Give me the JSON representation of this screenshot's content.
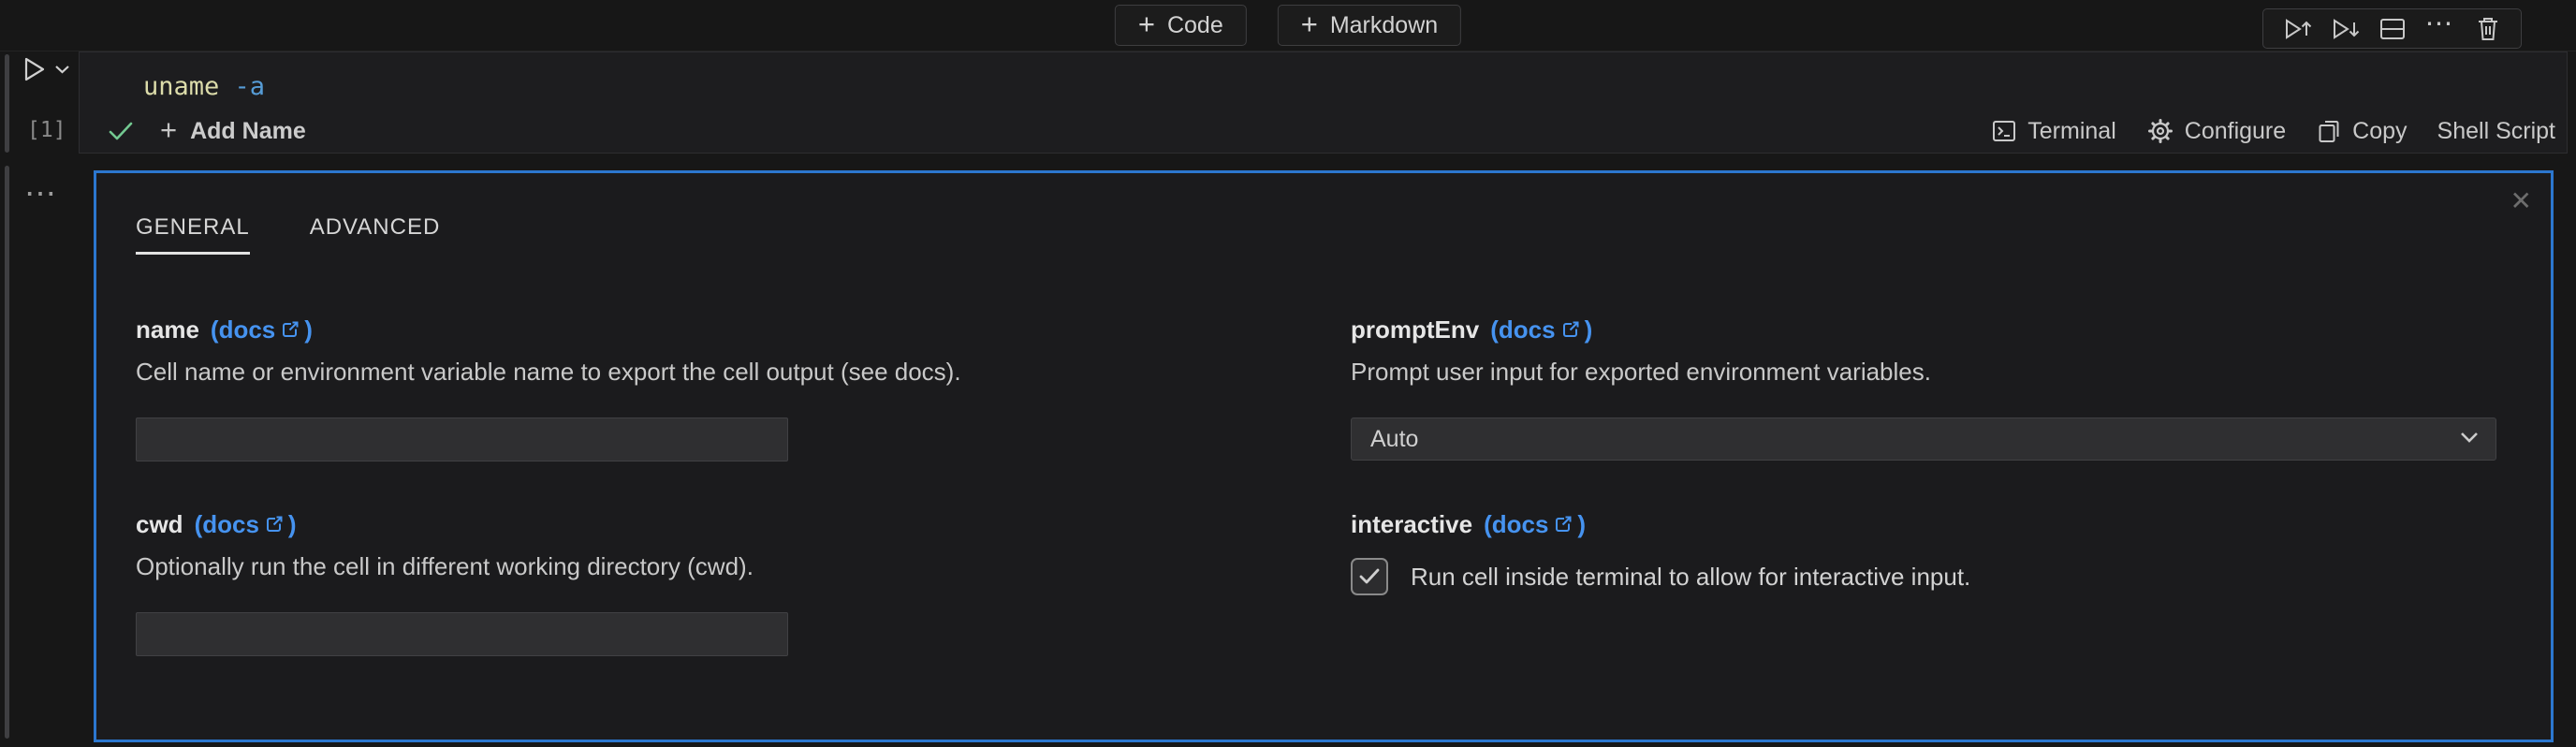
{
  "topbar": {
    "add_code_label": "Code",
    "add_markdown_label": "Markdown",
    "toolbar_icons": [
      "run-above",
      "run-below",
      "split-cell",
      "more-actions",
      "delete-cell"
    ]
  },
  "icons": {
    "plus": "+",
    "ellipsis": "⋯",
    "close": "✕",
    "run": "play-outline-with-dropdown-chevron",
    "status_check": "checkmark",
    "terminal": "terminal-box",
    "configure": "gear",
    "copy": "copy-pages",
    "docs_external": "external-link-arrow",
    "select_chevron": "chevron-down"
  },
  "cell": {
    "execution_count": "[1]",
    "code": {
      "command": "uname",
      "argument": " -a"
    },
    "status": {
      "add_name_label": "Add Name",
      "terminal_label": "Terminal",
      "configure_label": "Configure",
      "copy_label": "Copy",
      "language_label": "Shell Script"
    }
  },
  "panel": {
    "tabs": [
      {
        "label": "GENERAL",
        "active": true
      },
      {
        "label": "ADVANCED",
        "active": false
      }
    ],
    "docs": {
      "prefix": "(docs",
      "suffix": ")"
    },
    "fields": {
      "name": {
        "label": "name",
        "description": "Cell name or environment variable name to export the cell output (see docs).",
        "value": "",
        "placeholder": ""
      },
      "cwd": {
        "label": "cwd",
        "description": "Optionally run the cell in different working directory (cwd).",
        "value": "",
        "placeholder": ""
      },
      "promptEnv": {
        "label": "promptEnv",
        "description": "Prompt user input for exported environment variables.",
        "value": "Auto"
      },
      "interactive": {
        "label": "interactive",
        "checkbox_label": "Run cell inside terminal to allow for interactive input.",
        "checked": true
      }
    }
  },
  "colors": {
    "focus_border_blue": "#2c77cf",
    "link_blue": "#4693f0",
    "code_command": "#dcdcaa",
    "code_argument": "#569cd6",
    "success_green": "#73c991",
    "input_background": "#2f2f31",
    "page_background": "#171717"
  }
}
